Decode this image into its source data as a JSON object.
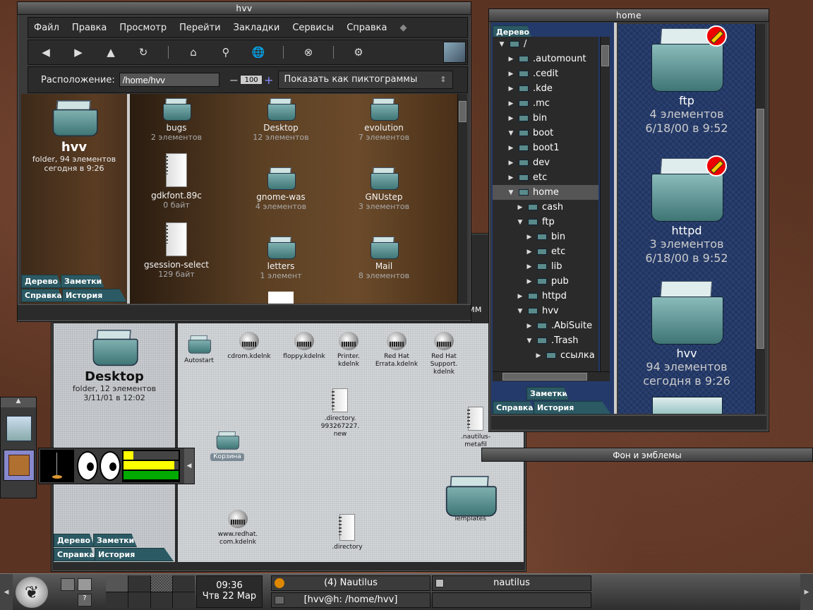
{
  "hvv_window": {
    "title": "hvv",
    "menu": [
      "Файл",
      "Правка",
      "Просмотр",
      "Перейти",
      "Закладки",
      "Сервисы",
      "Справка"
    ],
    "toolbar_icons": [
      "back-icon",
      "forward-icon",
      "up-icon",
      "reload-icon",
      "home-icon",
      "search-icon",
      "web-search-icon",
      "stop-icon",
      "services-icon"
    ],
    "location_label": "Расположение:",
    "location_value": "/home/hvv",
    "zoom_level": "100",
    "zoom_minus": "−",
    "zoom_plus": "+",
    "view_as": "Показать как пиктограммы",
    "sidebar": {
      "name": "hvv",
      "info": "folder, 94 элементов",
      "date": "сегодня в 9:26"
    },
    "tabs": [
      "Дерево",
      "Заметки",
      "Справка",
      "История"
    ],
    "items": [
      {
        "name": "bugs",
        "sub": "2 элементов",
        "kind": "folder"
      },
      {
        "name": "Desktop",
        "sub": "12 элементов",
        "kind": "folder"
      },
      {
        "name": "evolution",
        "sub": "7 элементов",
        "kind": "folder"
      },
      {
        "name": "gdkfont.89c",
        "sub": "0 байт",
        "kind": "doc"
      },
      {
        "name": "gnome-was",
        "sub": "4 элементов",
        "kind": "folder"
      },
      {
        "name": "GNUstep",
        "sub": "3 элементов",
        "kind": "folder"
      },
      {
        "name": "gsession-select",
        "sub": "129 байт",
        "kind": "doc"
      },
      {
        "name": "letters",
        "sub": "1 элемент",
        "kind": "folder"
      },
      {
        "name": "Mail",
        "sub": "8 элементов",
        "kind": "folder"
      }
    ]
  },
  "desktop_window": {
    "sidebar": {
      "name": "Desktop",
      "info": "folder, 12 элементов",
      "date": "3/11/01 в 12:02"
    },
    "tabs": [
      "Дерево",
      "Заметки",
      "Справка",
      "История"
    ],
    "partial_label": "мм",
    "icons": {
      "autostart": "Autostart",
      "cdrom": "cdrom.kdelnk",
      "floppy": "floppy.kdelnk",
      "printer1": "Printer.",
      "printer2": "kdelnk",
      "errata1": "Red Hat",
      "errata2": "Errata.kdelnk",
      "support1": "Red Hat",
      "support2": "Support.",
      "support3": "kdelnk",
      "dir1": ".directory.",
      "dir2": "993267227.",
      "dir3": "new",
      "meta1": ".nautilus-",
      "meta2": "metafil",
      "trash": "Корзина",
      "redhat1": "www.redhat.",
      "redhat2": "com.kdelnk",
      "directory": ".directory",
      "templates": "Templates"
    }
  },
  "home_window": {
    "title": "home",
    "tree_tab": "Дерево",
    "tree": [
      {
        "label": "/",
        "depth": 0,
        "open": true
      },
      {
        "label": ".automount",
        "depth": 1
      },
      {
        "label": ".cedit",
        "depth": 1
      },
      {
        "label": ".kde",
        "depth": 1
      },
      {
        "label": ".mc",
        "depth": 1
      },
      {
        "label": "bin",
        "depth": 1
      },
      {
        "label": "boot",
        "depth": 1,
        "open": true
      },
      {
        "label": "boot1",
        "depth": 1
      },
      {
        "label": "dev",
        "depth": 1
      },
      {
        "label": "etc",
        "depth": 1
      },
      {
        "label": "home",
        "depth": 1,
        "open": true,
        "selected": true
      },
      {
        "label": "cash",
        "depth": 2
      },
      {
        "label": "ftp",
        "depth": 2,
        "open": true
      },
      {
        "label": "bin",
        "depth": 3
      },
      {
        "label": "etc",
        "depth": 3
      },
      {
        "label": "lib",
        "depth": 3
      },
      {
        "label": "pub",
        "depth": 3
      },
      {
        "label": "httpd",
        "depth": 2
      },
      {
        "label": "hvv",
        "depth": 2,
        "open": true
      },
      {
        "label": ".AbiSuite",
        "depth": 3
      },
      {
        "label": ".Trash",
        "depth": 3,
        "open": true
      },
      {
        "label": "ссылка",
        "depth": 4
      }
    ],
    "tabs": [
      "Заметки",
      "Справка",
      "История"
    ],
    "folders": [
      {
        "name": "ftp",
        "count": "4 элементов",
        "date": "6/18/00 в 9:52"
      },
      {
        "name": "httpd",
        "count": "3 элементов",
        "date": "6/18/00 в 9:52"
      },
      {
        "name": "hvv",
        "count": "94 элементов",
        "date": "сегодня в 9:26"
      }
    ]
  },
  "bg_emblems_title": "Фон и эмблемы",
  "panel": {
    "time": "09:36",
    "date": "Чтв 22 Мар",
    "task1": "(4) Nautilus",
    "task2": "nautilus",
    "task3": "[hvv@h: /home/hvv]"
  }
}
